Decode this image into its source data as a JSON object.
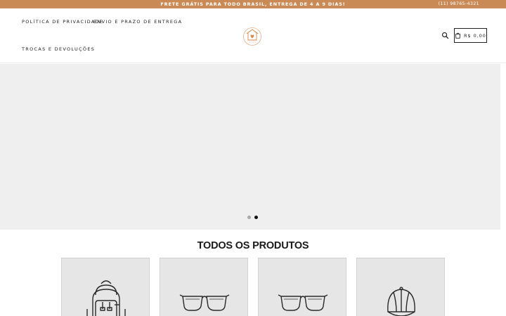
{
  "announcement": {
    "text": "FRETE GRÁTIS PARA TODO BRASIL, ENTREGA DE 4 A 9 DIAS!",
    "phone": "(11) 98765-4321"
  },
  "nav": {
    "items": [
      {
        "label": "POLÍTICA DE PRIVACIDADE"
      },
      {
        "label": "ENVIO E PRAZO DE ENTREGA"
      },
      {
        "label": "TROCAS E DEVOLUÇÕES"
      }
    ]
  },
  "header": {
    "logo_icon": "house-heart-logo",
    "search_icon": "search-icon",
    "cart_icon": "shopping-bag-icon",
    "cart_total": "R$ 0,00"
  },
  "slideshow": {
    "slide_count": 2,
    "active_slide": 2
  },
  "products_section": {
    "title": "TODOS OS PRODUTOS",
    "products": [
      {
        "image": "backpack-icon"
      },
      {
        "image": "sunglasses-icon"
      },
      {
        "image": "sunglasses-icon"
      },
      {
        "image": "cap-icon"
      }
    ]
  },
  "colors": {
    "announcement_bg": "#c98a55",
    "slideshow_bg": "#efefef",
    "card_bg": "#e6e6e6",
    "text": "#1f1f1f"
  }
}
